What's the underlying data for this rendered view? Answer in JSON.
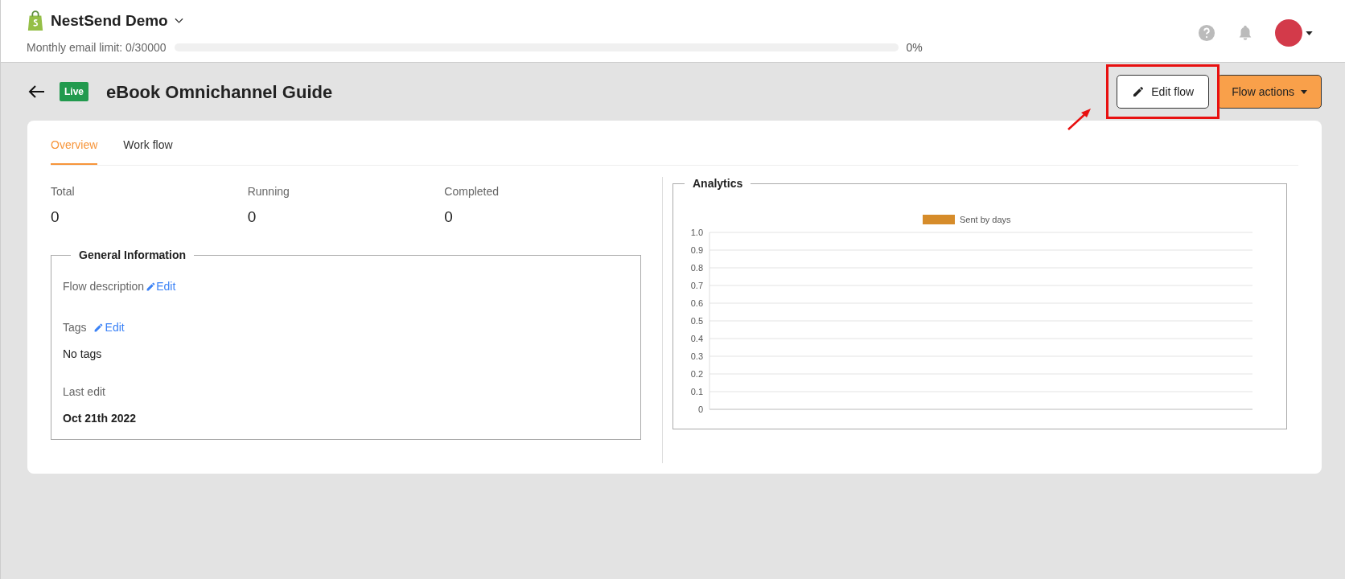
{
  "header": {
    "store_name": "NestSend Demo",
    "email_limit": {
      "label": "Monthly email limit: 0/30000",
      "level": 0,
      "reading": "0%"
    }
  },
  "page": {
    "status_badge": "Live",
    "title": "eBook Omnichannel Guide",
    "buttons": [
      {
        "kind": "outline",
        "label": "Edit flow",
        "highlighted": true
      },
      {
        "kind": "dropdown",
        "label": "Flow actions",
        "highlighted": false
      }
    ]
  },
  "tabs": [
    {
      "label": "Overview",
      "selected": true
    },
    {
      "label": "Work flow",
      "selected": false
    }
  ],
  "stats": [
    {
      "label": "Total",
      "value": "0"
    },
    {
      "label": "Running",
      "value": "0"
    },
    {
      "label": "Completed",
      "value": "0"
    }
  ],
  "general_information": {
    "title": "General Information",
    "description_label": "Flow description",
    "description_edit": "Edit",
    "tags_label": "Tags",
    "tags_edit": "Edit",
    "tags_value": "No tags",
    "last_edit_label": "Last edit",
    "last_edit_value": "Oct 21th 2022"
  },
  "analytics": {
    "title": "Analytics",
    "chart_data": {
      "type": "bar",
      "grid": true,
      "ylim": [
        0,
        1
      ],
      "yticks": [
        {
          "value": 0,
          "label": "0"
        },
        {
          "value": 0.1,
          "label": "0.1"
        },
        {
          "value": 0.2,
          "label": "0.2"
        },
        {
          "value": 0.3,
          "label": "0.3"
        },
        {
          "value": 0.4,
          "label": "0.4"
        },
        {
          "value": 0.5,
          "label": "0.5"
        },
        {
          "value": 0.6,
          "label": "0.6"
        },
        {
          "value": 0.7,
          "label": "0.7"
        },
        {
          "value": 0.8,
          "label": "0.8"
        },
        {
          "value": 0.9,
          "label": "0.9"
        },
        {
          "value": 1,
          "label": "1.0"
        }
      ],
      "series": [
        {
          "name": "Sent by days",
          "color": "#d68c2a"
        }
      ]
    }
  }
}
